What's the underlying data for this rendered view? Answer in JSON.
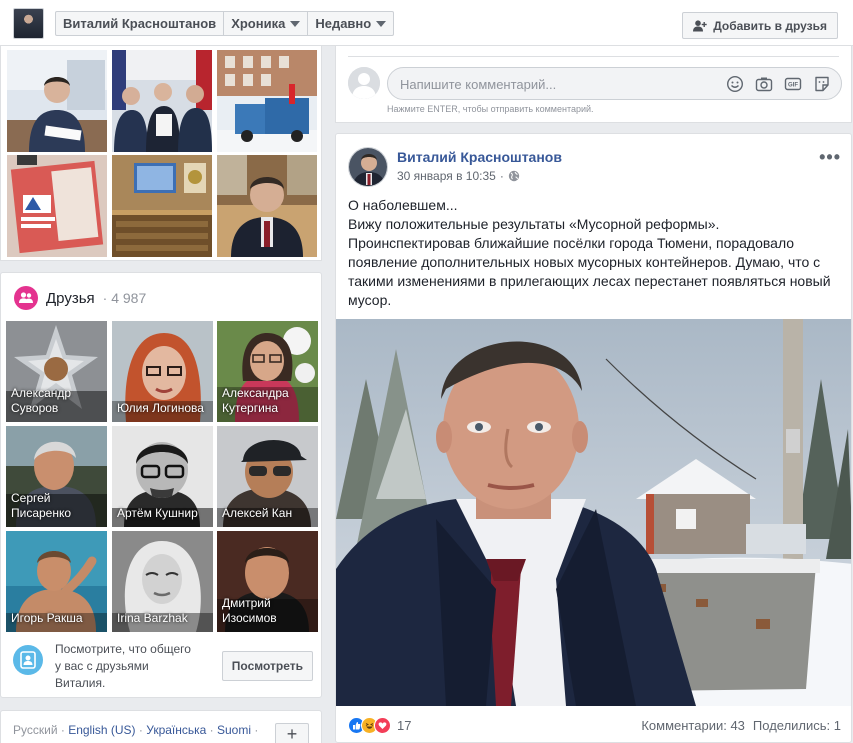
{
  "topbar": {
    "profile_name": "Виталий Красноштанов",
    "timeline_label": "Хроника",
    "recent_label": "Недавно",
    "add_friend_label": "Добавить в друзья"
  },
  "friends": {
    "title": "Друзья",
    "count": "· 4 987",
    "people": [
      {
        "name_line1": "Александр",
        "name_line2": "Суворов"
      },
      {
        "name_line1": "Юлия Логинова",
        "name_line2": ""
      },
      {
        "name_line1": "Александра",
        "name_line2": "Кутергина"
      },
      {
        "name_line1": "Сергей",
        "name_line2": "Писаренко"
      },
      {
        "name_line1": "Артём Кушнир",
        "name_line2": ""
      },
      {
        "name_line1": "Алексей Кан",
        "name_line2": ""
      },
      {
        "name_line1": "Игорь Ракша",
        "name_line2": ""
      },
      {
        "name_line1": "Irina Barzhak",
        "name_line2": ""
      },
      {
        "name_line1": "Дмитрий",
        "name_line2": "Изосимов"
      }
    ],
    "common_text_line1": "Посмотрите, что общего",
    "common_text_line2": "у вас с друзьями",
    "common_text_line3": "Виталия.",
    "common_button": "Посмотреть"
  },
  "languages": {
    "items": [
      "Русский",
      "English (US)",
      "Українська",
      "Suomi"
    ],
    "sep": " · "
  },
  "comment": {
    "placeholder": "Напишите комментарий...",
    "hint": "Нажмите ENTER, чтобы отправить комментарий."
  },
  "post": {
    "author": "Виталий Красноштанов",
    "date": "30 января в 10:35",
    "more": "•••",
    "text_lines": [
      "О наболевшем...",
      "Вижу положительные результаты «Мусорной реформы».",
      "Проинспектировав ближайшие посёлки города Тюмени, порадовало",
      "появление дополнительных новых мусорных контейнеров. Думаю, что с",
      "такими изменениями в прилегающих лесах перестанет появляться новый",
      "мусор."
    ],
    "reaction_count": "17",
    "comments": "Комментарии: 43",
    "shares": "Поделились: 1"
  },
  "colors": {
    "link": "#385898",
    "like": "#1877f2",
    "haha": "#f7b125",
    "love": "#f33e58",
    "friends_icon": "#e4338f"
  },
  "icons": [
    "friend-add-icon",
    "friends-icon",
    "globe-icon",
    "smile-icon",
    "camera-icon",
    "gif-icon",
    "sticker-icon",
    "profile-icon",
    "plus-icon"
  ]
}
